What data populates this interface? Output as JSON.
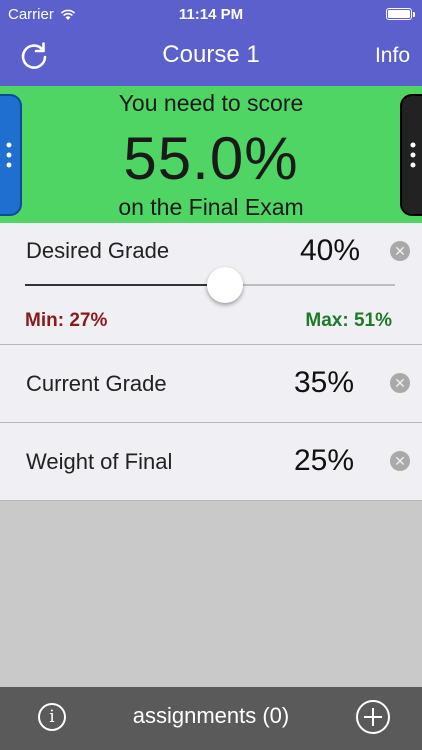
{
  "status_bar": {
    "carrier": "Carrier",
    "time": "11:14 PM",
    "wifi_icon": "wifi-icon",
    "battery_icon": "battery-icon"
  },
  "nav": {
    "title": "Course 1",
    "info_label": "Info",
    "refresh_icon": "refresh-icon"
  },
  "banner": {
    "line1": "You need to score",
    "required_score": "55.0%",
    "line2": "on the Final Exam",
    "color": "#4ed564"
  },
  "rows": {
    "desired_grade": {
      "label": "Desired Grade",
      "value": "40%",
      "min_label": "Min: 27%",
      "max_label": "Max: 51%",
      "slider_fraction": 0.54
    },
    "current_grade": {
      "label": "Current Grade",
      "value": "35%"
    },
    "weight_of_final": {
      "label": "Weight of Final",
      "value": "25%"
    }
  },
  "bottom_bar": {
    "info_icon_glyph": "i",
    "assignments_label": "assignments (0)",
    "add_icon": "plus-circle-icon"
  },
  "colors": {
    "nav_bar": "#5b60cd",
    "min_color": "#8b1a1a",
    "max_color": "#1f7a28"
  }
}
